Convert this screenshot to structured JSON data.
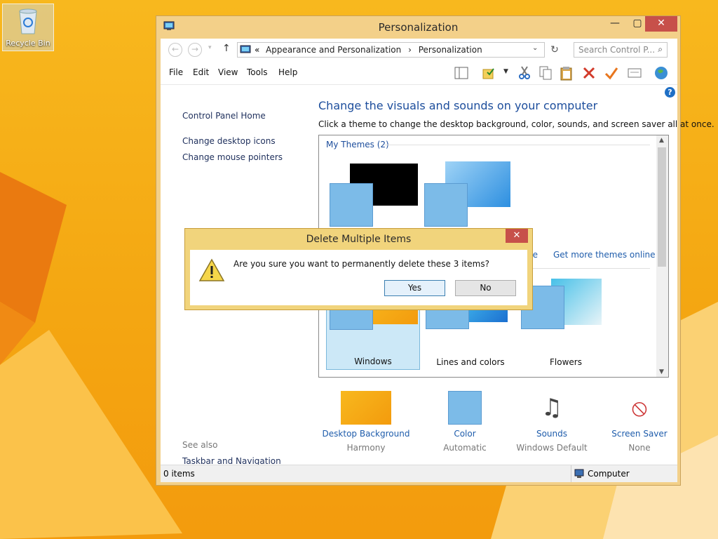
{
  "desktop": {
    "recycle_bin_label": "Recycle Bin"
  },
  "window": {
    "title": "Personalization",
    "breadcrumb": {
      "prefix": "«",
      "crumbs": [
        "Appearance and Personalization",
        "Personalization"
      ],
      "separator": "›"
    },
    "search_placeholder": "Search Control P...",
    "menu": [
      "File",
      "Edit",
      "View",
      "Tools",
      "Help"
    ],
    "left_links": [
      "Control Panel Home",
      "Change desktop icons",
      "Change mouse pointers"
    ],
    "see_also_label": "See also",
    "see_also_links": [
      "Taskbar and Navigation"
    ],
    "heading": "Change the visuals and sounds on your computer",
    "subheading": "Click a theme to change the desktop background, color, sounds, and screen saver all at once.",
    "my_themes_label": "My Themes (2)",
    "get_more_link": "Get more themes online",
    "partial_link": "ne",
    "themes": [
      "Windows",
      "Lines and colors",
      "Flowers"
    ],
    "bottom": [
      {
        "label": "Desktop Background",
        "value": "Harmony"
      },
      {
        "label": "Color",
        "value": "Automatic"
      },
      {
        "label": "Sounds",
        "value": "Windows Default"
      },
      {
        "label": "Screen Saver",
        "value": "None"
      }
    ],
    "status_items": "0 items",
    "status_computer": "Computer"
  },
  "dialog": {
    "title": "Delete Multiple Items",
    "message": "Are you sure you want to permanently delete these 3 items?",
    "yes": "Yes",
    "no": "No",
    "close": "✕"
  },
  "colors": {
    "accent": "#f3d089",
    "close_red": "#c7504a",
    "link_blue": "#1c4d9c"
  }
}
